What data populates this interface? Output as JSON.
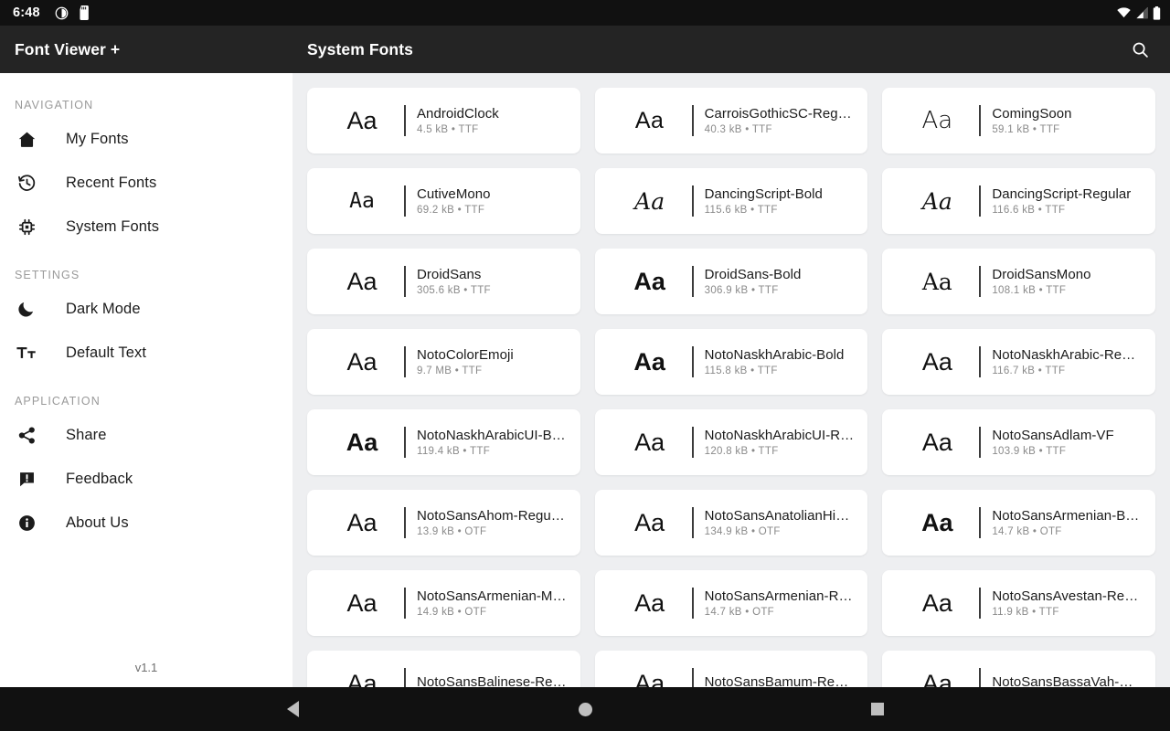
{
  "status_bar": {
    "time": "6:48",
    "left_icons": [
      "contrast-icon",
      "sd-card-icon"
    ],
    "right_icons": [
      "wifi-icon",
      "cell-signal-icon",
      "battery-icon"
    ]
  },
  "sidebar": {
    "app_title": "Font Viewer +",
    "version": "v1.1",
    "sections": [
      {
        "label": "NAVIGATION",
        "items": [
          {
            "label": "My Fonts",
            "icon": "home-icon"
          },
          {
            "label": "Recent Fonts",
            "icon": "history-icon"
          },
          {
            "label": "System Fonts",
            "icon": "chip-icon"
          }
        ]
      },
      {
        "label": "SETTINGS",
        "items": [
          {
            "label": "Dark Mode",
            "icon": "moon-icon"
          },
          {
            "label": "Default Text",
            "icon": "text-size-icon"
          }
        ]
      },
      {
        "label": "APPLICATION",
        "items": [
          {
            "label": "Share",
            "icon": "share-icon"
          },
          {
            "label": "Feedback",
            "icon": "feedback-icon"
          },
          {
            "label": "About Us",
            "icon": "info-icon"
          }
        ]
      }
    ]
  },
  "appbar": {
    "title": "System Fonts",
    "search_icon": "search-icon"
  },
  "font_grid": {
    "preview_text": "Aa",
    "cards": [
      {
        "name": "AndroidClock",
        "meta": "4.5 kB • TTF",
        "style": "pv-sans"
      },
      {
        "name": "CarroisGothicSC-Regul…",
        "meta": "40.3 kB • TTF",
        "style": "pv-caps"
      },
      {
        "name": "ComingSoon",
        "meta": "59.1 kB • TTF",
        "style": "pv-light"
      },
      {
        "name": "CutiveMono",
        "meta": "69.2 kB • TTF",
        "style": "pv-mono"
      },
      {
        "name": "DancingScript-Bold",
        "meta": "115.6 kB • TTF",
        "style": "pv-script"
      },
      {
        "name": "DancingScript-Regular",
        "meta": "116.6 kB • TTF",
        "style": "pv-script"
      },
      {
        "name": "DroidSans",
        "meta": "305.6 kB • TTF",
        "style": "pv-sans"
      },
      {
        "name": "DroidSans-Bold",
        "meta": "306.9 kB • TTF",
        "style": "pv-bold"
      },
      {
        "name": "DroidSansMono",
        "meta": "108.1 kB • TTF",
        "style": "pv-thin"
      },
      {
        "name": "NotoColorEmoji",
        "meta": "9.7 MB • TTF",
        "style": "pv-sans"
      },
      {
        "name": "NotoNaskhArabic-Bold",
        "meta": "115.8 kB • TTF",
        "style": "pv-bold"
      },
      {
        "name": "NotoNaskhArabic-Reg…",
        "meta": "116.7 kB • TTF",
        "style": "pv-sans"
      },
      {
        "name": "NotoNaskhArabicUI-B…",
        "meta": "119.4 kB • TTF",
        "style": "pv-bold"
      },
      {
        "name": "NotoNaskhArabicUI-R…",
        "meta": "120.8 kB • TTF",
        "style": "pv-sans"
      },
      {
        "name": "NotoSansAdlam-VF",
        "meta": "103.9 kB • TTF",
        "style": "pv-sans"
      },
      {
        "name": "NotoSansAhom-Regul…",
        "meta": "13.9 kB • OTF",
        "style": "pv-sans"
      },
      {
        "name": "NotoSansAnatolianHi…",
        "meta": "134.9 kB • OTF",
        "style": "pv-sans"
      },
      {
        "name": "NotoSansArmenian-B…",
        "meta": "14.7 kB • OTF",
        "style": "pv-bold"
      },
      {
        "name": "NotoSansArmenian-M…",
        "meta": "14.9 kB • OTF",
        "style": "pv-sans"
      },
      {
        "name": "NotoSansArmenian-R…",
        "meta": "14.7 kB • OTF",
        "style": "pv-sans"
      },
      {
        "name": "NotoSansAvestan-Re…",
        "meta": "11.9 kB • TTF",
        "style": "pv-sans"
      },
      {
        "name": "NotoSansBalinese-Re…",
        "meta": "",
        "style": "pv-sans"
      },
      {
        "name": "NotoSansBamum-Reg…",
        "meta": "",
        "style": "pv-sans"
      },
      {
        "name": "NotoSansBassaVah-R…",
        "meta": "",
        "style": "pv-sans"
      }
    ]
  },
  "system_navbar": {
    "back": "back-button",
    "home": "home-button",
    "recents": "recents-button"
  }
}
